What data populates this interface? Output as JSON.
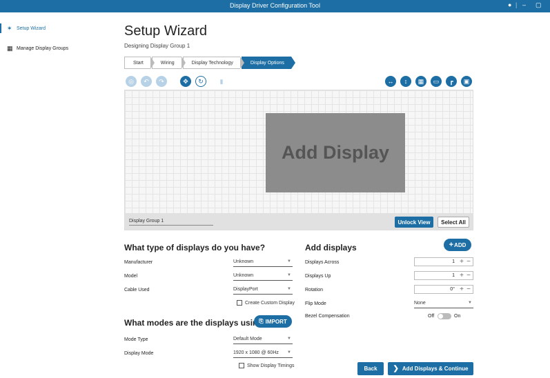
{
  "window": {
    "title": "Display Driver Configuration Tool"
  },
  "sidebar": {
    "items": [
      {
        "label": "Setup Wizard",
        "icon": "wand-icon",
        "active": true
      },
      {
        "label": "Manage Display Groups",
        "icon": "grid-icon",
        "active": false
      }
    ]
  },
  "page": {
    "title": "Setup Wizard",
    "subtitle": "Designing Display Group 1"
  },
  "wizard": {
    "steps": [
      "Start",
      "Wiring",
      "Display Technology",
      "Display Options"
    ],
    "active_index": 3
  },
  "canvas": {
    "placeholder": "Add Display",
    "group_name": "Display Group 1",
    "unlock_label": "Unlock View",
    "select_all_label": "Select All"
  },
  "displays_section": {
    "title": "What type of displays do you have?",
    "manufacturer_label": "Manufacturer",
    "manufacturer_value": "Unknown",
    "model_label": "Model",
    "model_value": "Unknown",
    "cable_label": "Cable Used",
    "cable_value": "DisplayPort",
    "custom_label": "Create Custom Display"
  },
  "modes_section": {
    "title": "What modes are the displays using?",
    "import_label": "IMPORT",
    "mode_type_label": "Mode Type",
    "mode_type_value": "Default Mode",
    "display_mode_label": "Display Mode",
    "display_mode_value": "1920 x 1080 @ 60Hz",
    "timings_label": "Show Display Timings"
  },
  "add_section": {
    "title": "Add displays",
    "add_label": "ADD",
    "across_label": "Displays Across",
    "across_value": "1",
    "up_label": "Displays Up",
    "up_value": "1",
    "rotation_label": "Rotation",
    "rotation_value": "0°",
    "flip_label": "Flip Mode",
    "flip_value": "None",
    "bezel_label": "Bezel Compensation",
    "bezel_off": "Off",
    "bezel_on": "On"
  },
  "footer": {
    "back_label": "Back",
    "continue_label": "Add Displays & Continue"
  },
  "colors": {
    "accent": "#1c6ea4",
    "disabled": "#b7d2e6"
  }
}
